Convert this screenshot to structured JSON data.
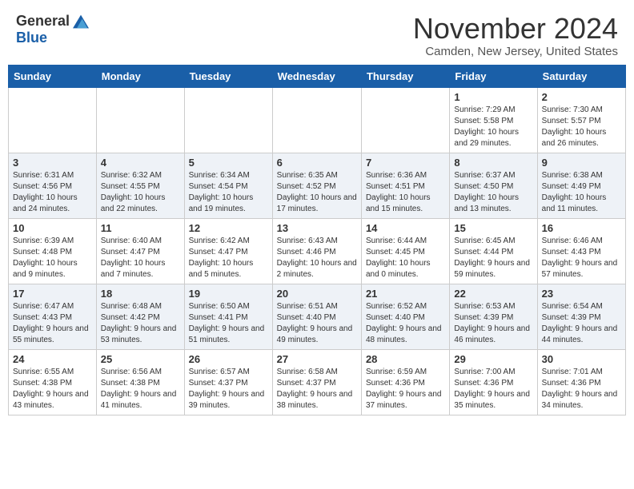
{
  "header": {
    "logo_general": "General",
    "logo_blue": "Blue",
    "month_title": "November 2024",
    "location": "Camden, New Jersey, United States"
  },
  "weekdays": [
    "Sunday",
    "Monday",
    "Tuesday",
    "Wednesday",
    "Thursday",
    "Friday",
    "Saturday"
  ],
  "weeks": [
    [
      {
        "day": "",
        "info": ""
      },
      {
        "day": "",
        "info": ""
      },
      {
        "day": "",
        "info": ""
      },
      {
        "day": "",
        "info": ""
      },
      {
        "day": "",
        "info": ""
      },
      {
        "day": "1",
        "info": "Sunrise: 7:29 AM\nSunset: 5:58 PM\nDaylight: 10 hours and 29 minutes."
      },
      {
        "day": "2",
        "info": "Sunrise: 7:30 AM\nSunset: 5:57 PM\nDaylight: 10 hours and 26 minutes."
      }
    ],
    [
      {
        "day": "3",
        "info": "Sunrise: 6:31 AM\nSunset: 4:56 PM\nDaylight: 10 hours and 24 minutes."
      },
      {
        "day": "4",
        "info": "Sunrise: 6:32 AM\nSunset: 4:55 PM\nDaylight: 10 hours and 22 minutes."
      },
      {
        "day": "5",
        "info": "Sunrise: 6:34 AM\nSunset: 4:54 PM\nDaylight: 10 hours and 19 minutes."
      },
      {
        "day": "6",
        "info": "Sunrise: 6:35 AM\nSunset: 4:52 PM\nDaylight: 10 hours and 17 minutes."
      },
      {
        "day": "7",
        "info": "Sunrise: 6:36 AM\nSunset: 4:51 PM\nDaylight: 10 hours and 15 minutes."
      },
      {
        "day": "8",
        "info": "Sunrise: 6:37 AM\nSunset: 4:50 PM\nDaylight: 10 hours and 13 minutes."
      },
      {
        "day": "9",
        "info": "Sunrise: 6:38 AM\nSunset: 4:49 PM\nDaylight: 10 hours and 11 minutes."
      }
    ],
    [
      {
        "day": "10",
        "info": "Sunrise: 6:39 AM\nSunset: 4:48 PM\nDaylight: 10 hours and 9 minutes."
      },
      {
        "day": "11",
        "info": "Sunrise: 6:40 AM\nSunset: 4:47 PM\nDaylight: 10 hours and 7 minutes."
      },
      {
        "day": "12",
        "info": "Sunrise: 6:42 AM\nSunset: 4:47 PM\nDaylight: 10 hours and 5 minutes."
      },
      {
        "day": "13",
        "info": "Sunrise: 6:43 AM\nSunset: 4:46 PM\nDaylight: 10 hours and 2 minutes."
      },
      {
        "day": "14",
        "info": "Sunrise: 6:44 AM\nSunset: 4:45 PM\nDaylight: 10 hours and 0 minutes."
      },
      {
        "day": "15",
        "info": "Sunrise: 6:45 AM\nSunset: 4:44 PM\nDaylight: 9 hours and 59 minutes."
      },
      {
        "day": "16",
        "info": "Sunrise: 6:46 AM\nSunset: 4:43 PM\nDaylight: 9 hours and 57 minutes."
      }
    ],
    [
      {
        "day": "17",
        "info": "Sunrise: 6:47 AM\nSunset: 4:43 PM\nDaylight: 9 hours and 55 minutes."
      },
      {
        "day": "18",
        "info": "Sunrise: 6:48 AM\nSunset: 4:42 PM\nDaylight: 9 hours and 53 minutes."
      },
      {
        "day": "19",
        "info": "Sunrise: 6:50 AM\nSunset: 4:41 PM\nDaylight: 9 hours and 51 minutes."
      },
      {
        "day": "20",
        "info": "Sunrise: 6:51 AM\nSunset: 4:40 PM\nDaylight: 9 hours and 49 minutes."
      },
      {
        "day": "21",
        "info": "Sunrise: 6:52 AM\nSunset: 4:40 PM\nDaylight: 9 hours and 48 minutes."
      },
      {
        "day": "22",
        "info": "Sunrise: 6:53 AM\nSunset: 4:39 PM\nDaylight: 9 hours and 46 minutes."
      },
      {
        "day": "23",
        "info": "Sunrise: 6:54 AM\nSunset: 4:39 PM\nDaylight: 9 hours and 44 minutes."
      }
    ],
    [
      {
        "day": "24",
        "info": "Sunrise: 6:55 AM\nSunset: 4:38 PM\nDaylight: 9 hours and 43 minutes."
      },
      {
        "day": "25",
        "info": "Sunrise: 6:56 AM\nSunset: 4:38 PM\nDaylight: 9 hours and 41 minutes."
      },
      {
        "day": "26",
        "info": "Sunrise: 6:57 AM\nSunset: 4:37 PM\nDaylight: 9 hours and 39 minutes."
      },
      {
        "day": "27",
        "info": "Sunrise: 6:58 AM\nSunset: 4:37 PM\nDaylight: 9 hours and 38 minutes."
      },
      {
        "day": "28",
        "info": "Sunrise: 6:59 AM\nSunset: 4:36 PM\nDaylight: 9 hours and 37 minutes."
      },
      {
        "day": "29",
        "info": "Sunrise: 7:00 AM\nSunset: 4:36 PM\nDaylight: 9 hours and 35 minutes."
      },
      {
        "day": "30",
        "info": "Sunrise: 7:01 AM\nSunset: 4:36 PM\nDaylight: 9 hours and 34 minutes."
      }
    ]
  ]
}
